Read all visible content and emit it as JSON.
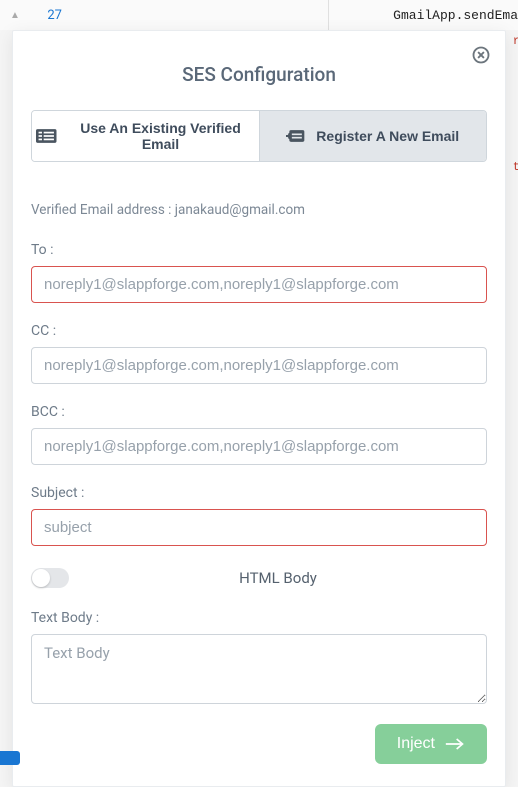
{
  "editor": {
    "line_number": "27",
    "code_snippet": "GmailApp.sendEma",
    "right_cut": "r",
    "hint_t": "t"
  },
  "modal": {
    "title": "SES Configuration",
    "tabs": {
      "existing": "Use An Existing Verified Email",
      "register": "Register A New Email"
    },
    "verified_label": "Verified Email address : janakaud@gmail.com",
    "fields": {
      "to_label": "To :",
      "to_placeholder": "noreply1@slappforge.com,noreply1@slappforge.com",
      "cc_label": "CC :",
      "cc_placeholder": "noreply1@slappforge.com,noreply1@slappforge.com",
      "bcc_label": "BCC :",
      "bcc_placeholder": "noreply1@slappforge.com,noreply1@slappforge.com",
      "subject_label": "Subject :",
      "subject_placeholder": "subject",
      "html_body_label": "HTML Body",
      "text_body_label": "Text Body :",
      "text_body_placeholder": "Text Body"
    },
    "inject_label": "Inject"
  }
}
